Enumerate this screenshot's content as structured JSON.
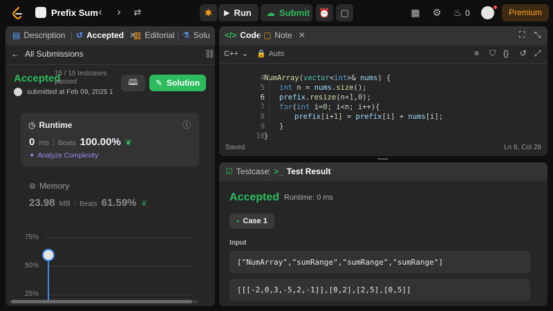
{
  "topbar": {
    "problem_title": "Prefix Sum",
    "run_label": "Run",
    "submit_label": "Submit",
    "notifications_count": "0",
    "premium_label": "Premium"
  },
  "left_panel": {
    "tabs": [
      {
        "label": "Description"
      },
      {
        "label": "Accepted"
      },
      {
        "label": "Editorial"
      },
      {
        "label": "Solu"
      }
    ],
    "back_label": "All Submissions",
    "status": "Accepted",
    "testcases": "15 / 15 testcases",
    "passed": "passed",
    "submitted": "submitted at Feb 09, 2025 13:0",
    "solution_button": "Solution",
    "runtime": {
      "title": "Runtime",
      "value": "0",
      "unit": "ms",
      "beats_label": "Beats",
      "beats_value": "100.00%",
      "analyze": "Analyze Complexity"
    },
    "memory": {
      "title": "Memory",
      "value": "23.98",
      "unit": "MB",
      "beats_label": "Beats",
      "beats_value": "61.59%"
    },
    "chart_labels": [
      "75%",
      "50%",
      "25%"
    ]
  },
  "code_panel": {
    "tabs": [
      {
        "label": "Code"
      },
      {
        "label": "Note"
      }
    ],
    "language": "C++",
    "mode": "Auto",
    "line_numbers": [
      "4",
      "5",
      "6",
      "7",
      "8",
      "9",
      "10"
    ],
    "saved_label": "Saved",
    "cursor_pos": "Ln 6, Col 28"
  },
  "result_panel": {
    "tabs": [
      {
        "label": "Testcase"
      },
      {
        "label": "Test Result"
      }
    ],
    "status": "Accepted",
    "runtime": "Runtime: 0 ms",
    "case_label": "Case 1",
    "input_label": "Input",
    "input_line1": "[\"NumArray\",\"sumRange\",\"sumRange\",\"sumRange\"]",
    "input_line2": "[[[-2,0,3,-5,2,-1]],[0,2],[2,5],[0,5]]"
  },
  "colors": {
    "accent_green": "#2cbb5d",
    "premium_orange": "#ffa116",
    "panel_bg": "#262626"
  }
}
